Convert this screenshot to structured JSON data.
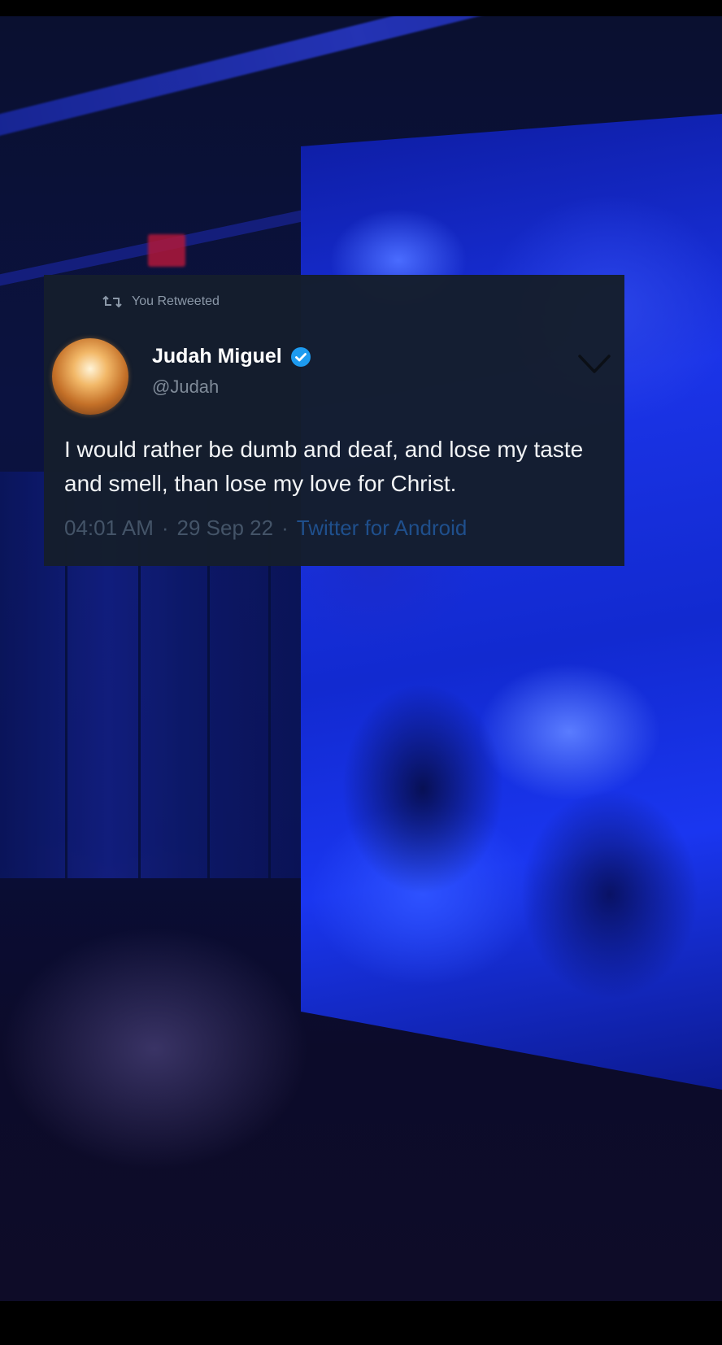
{
  "tweet": {
    "retweet_label": "You Retweeted",
    "display_name": "Judah Miguel",
    "handle": "@Judah",
    "text": "I would rather be dumb and deaf, and lose my taste and smell, than lose my love for Christ.",
    "time": "04:01 AM",
    "date": "29 Sep 22",
    "client": "Twitter for Android",
    "separator": "·",
    "icons": {
      "retweet": "retweet-icon",
      "verified": "verified-badge-icon",
      "menu": "chevron-down-icon"
    }
  },
  "colors": {
    "card_background": "#151e2c",
    "text_primary": "#f2f4f6",
    "text_secondary": "#8b98a8",
    "verified_blue": "#1d9bf0",
    "client_link": "#1f4f8c"
  }
}
